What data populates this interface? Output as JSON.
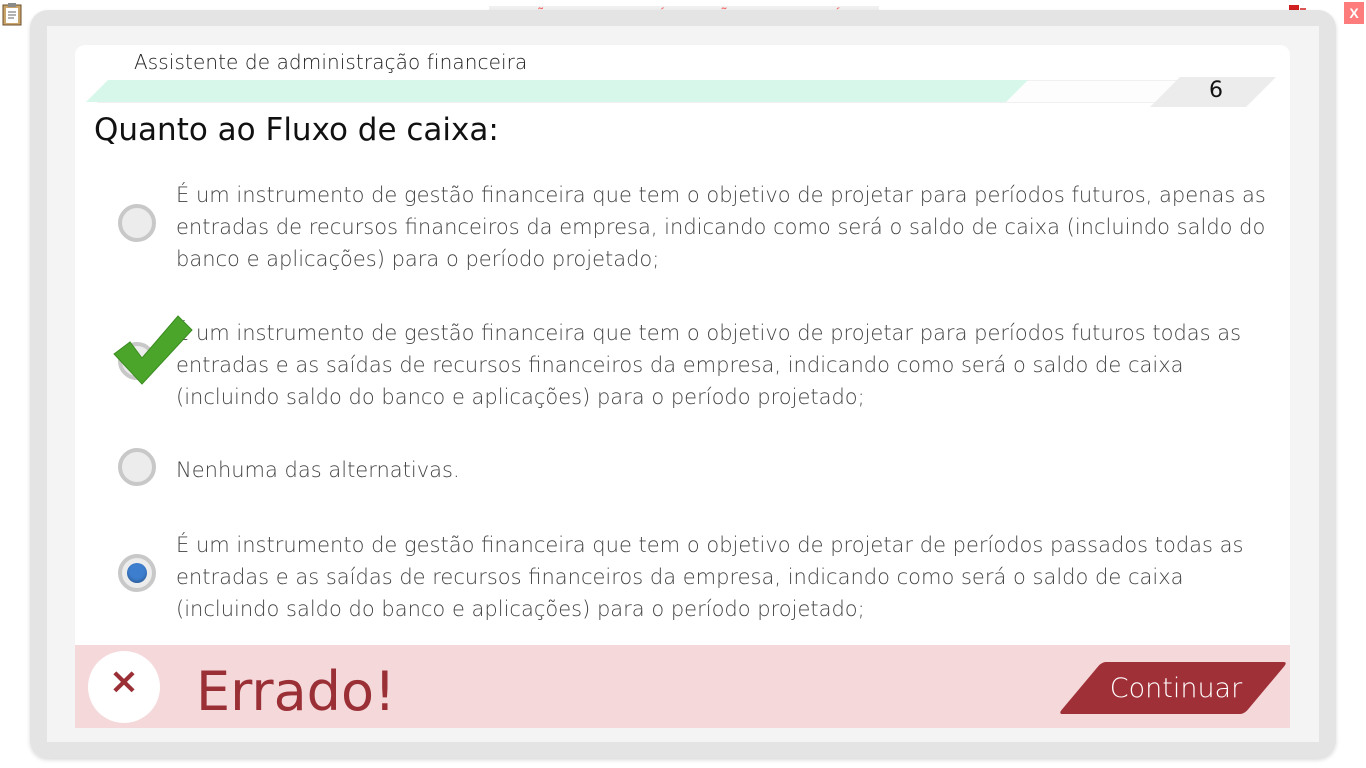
{
  "top_bar": {
    "version_banner": "VERSÃO PARA FUNCIONÁRIOS - NÃO COMERCIALIZÁVEL",
    "close_label": "X"
  },
  "header": {
    "course_title": "Assistente de administração financeira",
    "page_number": "6",
    "progress_fraction": 0.85
  },
  "question": {
    "title": "Quanto ao Fluxo de caixa:",
    "options": [
      {
        "text": "É um instrumento de gestão financeira que tem o objetivo de projetar para períodos futuros, apenas as entradas de recursos financeiros da empresa, indicando como será o saldo de caixa (incluindo saldo do banco e aplicações) para o período projetado;",
        "selected": false,
        "correct": false
      },
      {
        "text": "É um instrumento de gestão financeira que tem o objetivo de projetar para períodos futuros todas as entradas e as saídas de recursos financeiros da empresa, indicando como será o saldo de caixa (incluindo saldo do banco e aplicações) para o período projetado;",
        "selected": false,
        "correct": true
      },
      {
        "text": "Nenhuma das alternativas.",
        "selected": false,
        "correct": false
      },
      {
        "text": "É um instrumento de gestão financeira que tem o objetivo de projetar de períodos passados todas as entradas e as saídas de recursos financeiros da empresa, indicando como será o saldo de caixa (incluindo saldo do banco e aplicações) para o período projetado;",
        "selected": true,
        "correct": false
      }
    ]
  },
  "feedback": {
    "icon": "×",
    "text": "Errado!",
    "continue_label": "Continuar"
  },
  "colors": {
    "accent_red": "#9a3036",
    "radio_selected": "#3d7ecf",
    "check_green": "#4aa52a",
    "progress_fill": "#d6f7ea"
  }
}
